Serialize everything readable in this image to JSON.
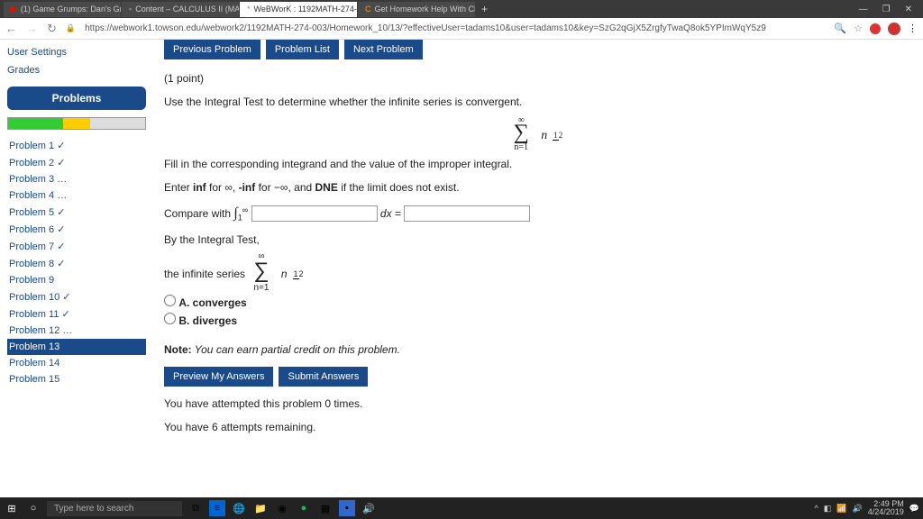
{
  "tabs": [
    {
      "icon": "▶",
      "label": "(1) Game Grumps: Dan's Gr",
      "iconColor": "#f00"
    },
    {
      "icon": "▪",
      "label": "Content – CALCULUS II (MATH27"
    },
    {
      "icon": "*",
      "label": "WeBWorK : 1192MATH-274-003",
      "active": true
    },
    {
      "icon": "C",
      "label": "Get Homework Help With Chegg",
      "iconColor": "#f90"
    }
  ],
  "url": "https://webwork1.towson.edu/webwork2/1192MATH-274-003/Homework_10/13/?effectiveUser=tadams10&user=tadams10&key=SzG2qGjX5ZrgfyTwaQ8ok5YPImWqY5z9",
  "sidebar": {
    "nav": [
      "User Settings",
      "Grades"
    ],
    "header": "Problems",
    "items": [
      {
        "t": "Problem 1 ✓"
      },
      {
        "t": "Problem 2 ✓"
      },
      {
        "t": "Problem 3 …",
        "d": true
      },
      {
        "t": "Problem 4 …",
        "d": true
      },
      {
        "t": "Problem 5 ✓"
      },
      {
        "t": "Problem 6 ✓"
      },
      {
        "t": "Problem 7 ✓"
      },
      {
        "t": "Problem 8 ✓"
      },
      {
        "t": "Problem 9"
      },
      {
        "t": "Problem 10 ✓"
      },
      {
        "t": "Problem 11 ✓"
      },
      {
        "t": "Problem 12 …",
        "d": true
      },
      {
        "t": "Problem 13",
        "c": true
      },
      {
        "t": "Problem 14"
      },
      {
        "t": "Problem 15"
      }
    ]
  },
  "buttons": {
    "prev": "Previous Problem",
    "list": "Problem List",
    "next": "Next Problem",
    "preview": "Preview My Answers",
    "submit": "Submit Answers"
  },
  "problem": {
    "points": "(1 point)",
    "instr": "Use the Integral Test to determine whether the infinite series is convergent.",
    "fill": "Fill in the corresponding integrand and the value of the improper integral.",
    "enter": "Enter inf for ∞, -inf for −∞, and DNE if the limit does not exist.",
    "compare": "Compare with",
    "dx": "dx =",
    "byTest": "By the Integral Test,",
    "series": "the infinite series",
    "optA": "A. converges",
    "optB": "B. diverges",
    "note": "Note:",
    "noteText": " You can earn partial credit on this problem.",
    "attempts": "You have attempted this problem 0 times.",
    "remaining": "You have 6 attempts remaining."
  },
  "taskbar": {
    "search": "Type here to search",
    "time": "2:49 PM",
    "date": "4/24/2019"
  }
}
